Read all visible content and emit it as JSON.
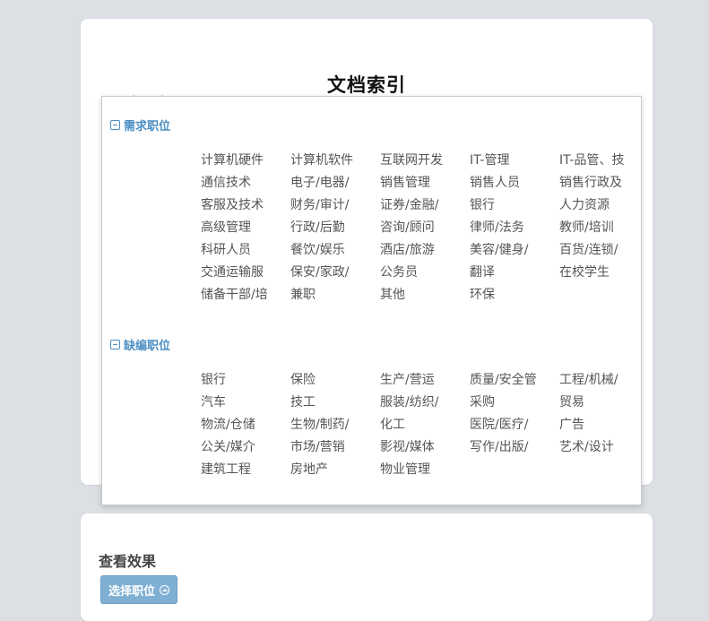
{
  "document": {
    "title": "文档索引"
  },
  "popup": {
    "categories": [
      {
        "name": "需求职位",
        "items": [
          "计算机硬件",
          "计算机软件",
          "互联网开发",
          "IT-管理",
          "IT-品管、技",
          "通信技术",
          "电子/电器/",
          "销售管理",
          "销售人员",
          "销售行政及",
          "客服及技术",
          "财务/审计/",
          "证券/金融/",
          "银行",
          "人力资源",
          "高级管理",
          "行政/后勤",
          "咨询/顾问",
          "律师/法务",
          "教师/培训",
          "科研人员",
          "餐饮/娱乐",
          "酒店/旅游",
          "美容/健身/",
          "百货/连锁/",
          "交通运输服",
          "保安/家政/",
          "公务员",
          "翻译",
          "在校学生",
          "储备干部/培",
          "兼职",
          "其他",
          "环保"
        ]
      },
      {
        "name": "缺编职位",
        "items": [
          "银行",
          "保险",
          "生产/营运",
          "质量/安全管",
          "工程/机械/",
          "汽车",
          "技工",
          "服装/纺织/",
          "采购",
          "贸易",
          "物流/仓储",
          "生物/制药/",
          "化工",
          "医院/医疗/",
          "广告",
          "公关/媒介",
          "市场/营销",
          "影视/媒体",
          "写作/出版/",
          "艺术/设计",
          "建筑工程",
          "房地产",
          "物业管理"
        ]
      }
    ]
  },
  "demo": {
    "label": "查看效果",
    "button_label": "选择职位"
  }
}
